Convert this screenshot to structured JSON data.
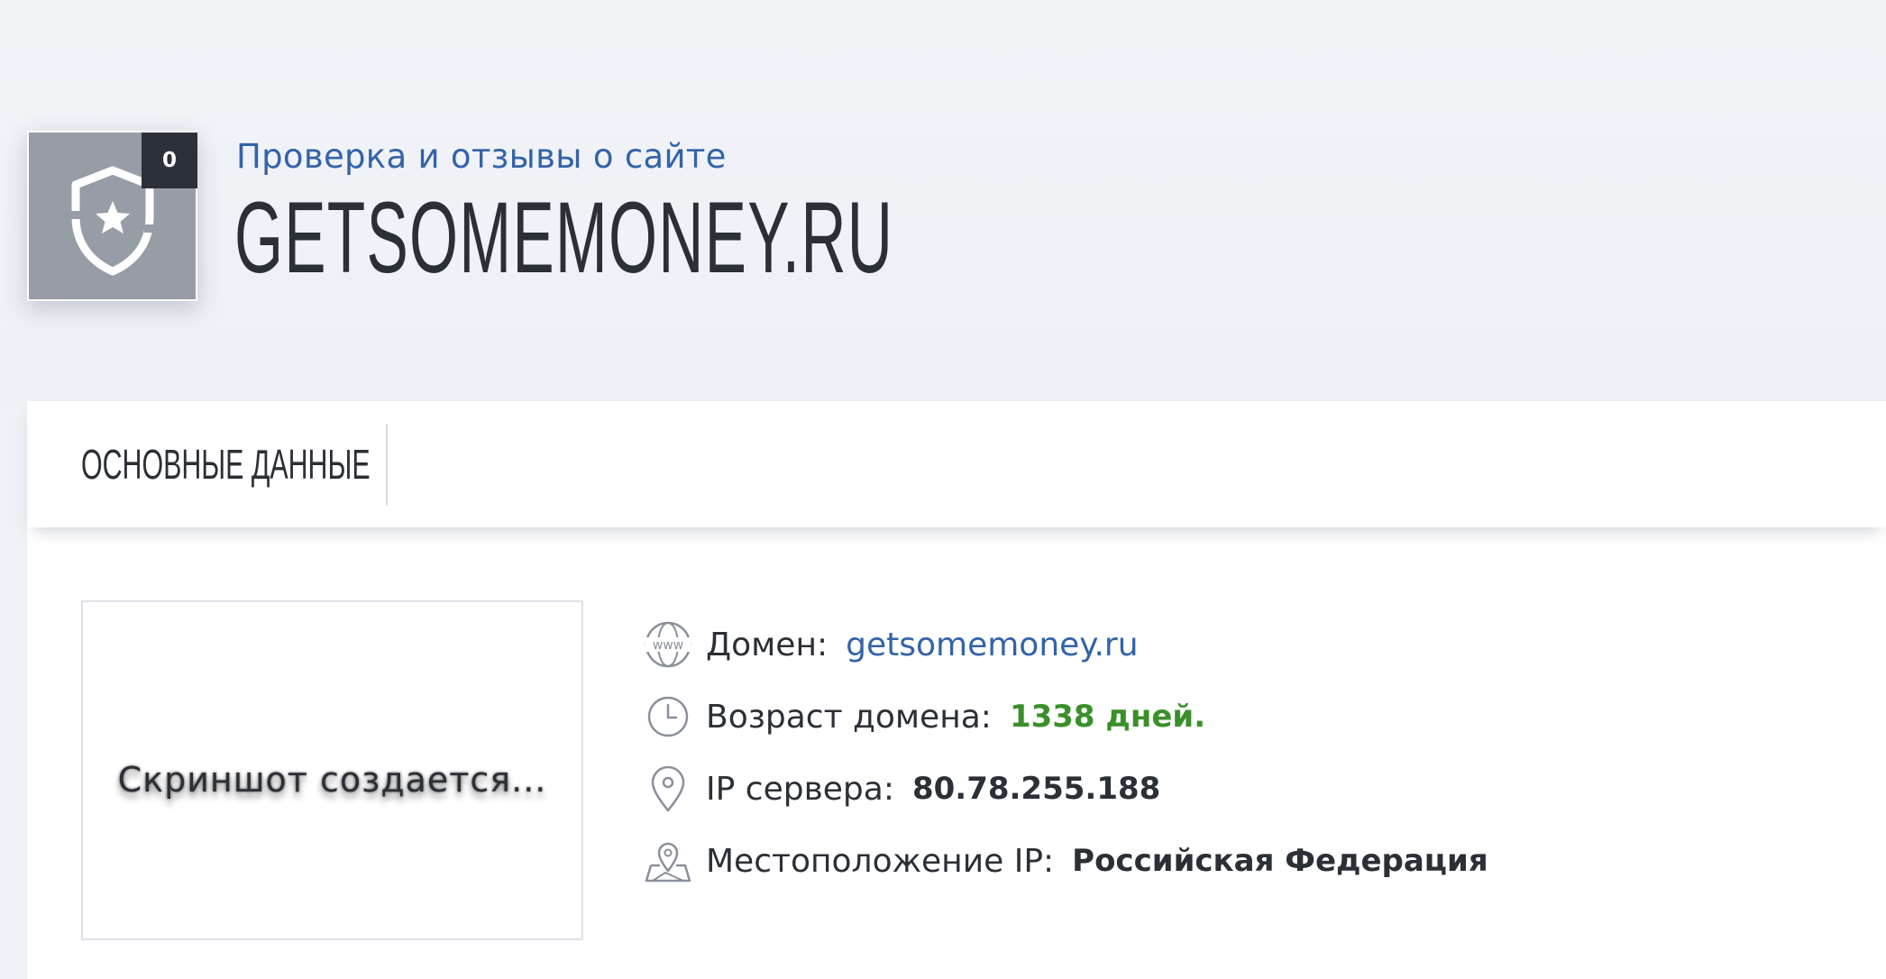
{
  "header": {
    "rating_badge": "0",
    "subtitle": "Проверка и отзывы о сайте",
    "site_title": "GETSOMEMONEY.RU"
  },
  "tabs": [
    {
      "label": "ОСНОВНЫЕ ДАННЫЕ",
      "active": true
    }
  ],
  "screenshot": {
    "placeholder_text": "Скриншот создается..."
  },
  "info": {
    "domain": {
      "label": "Домен:",
      "value": "getsomemoney.ru",
      "icon": "www-icon"
    },
    "age": {
      "label": "Возраст домена:",
      "value": "1338 дней.",
      "icon": "clock-icon"
    },
    "ip": {
      "label": "IP сервера:",
      "value": "80.78.255.188",
      "icon": "location-pin-icon"
    },
    "location": {
      "label": "Местоположение IP:",
      "value": "Российская Федерация",
      "icon": "map-pin-icon"
    }
  },
  "colors": {
    "accent_blue": "#3463a8",
    "age_green": "#3b8f2a",
    "badge_dark": "#2c3038",
    "logo_gray": "#979da6",
    "page_bg": "#eef1f6"
  }
}
